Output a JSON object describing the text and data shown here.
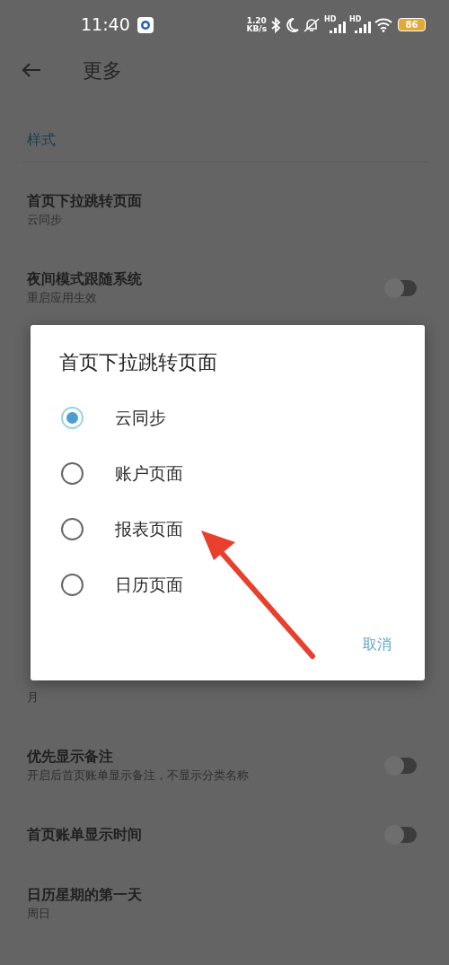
{
  "status_bar": {
    "time": "11:40",
    "net_speed": [
      "1.20",
      "KB/s"
    ],
    "signals": [
      {
        "label": "HD"
      },
      {
        "label": "HD"
      }
    ],
    "battery": "86"
  },
  "header": {
    "title": "更多"
  },
  "section": {
    "title": "样式"
  },
  "settings_above": [
    {
      "kind": "value",
      "title": "首页下拉跳转页面",
      "subtitle": "云同步"
    },
    {
      "kind": "toggle",
      "title": "夜间模式跟随系统",
      "subtitle": "重启应用生效",
      "on": false
    }
  ],
  "settings_below": [
    {
      "kind": "value",
      "subtitle": "月"
    },
    {
      "kind": "toggle",
      "title": "优先显示备注",
      "subtitle": "开启后首页账单显示备注，不显示分类名称",
      "on": false
    },
    {
      "kind": "toggle",
      "title": "首页账单显示时间",
      "on": false
    },
    {
      "kind": "value",
      "title": "日历星期的第一天",
      "subtitle": "周日"
    }
  ],
  "dialog": {
    "title": "首页下拉跳转页面",
    "options": [
      {
        "label": "云同步",
        "selected": true
      },
      {
        "label": "账户页面",
        "selected": false
      },
      {
        "label": "报表页面",
        "selected": false
      },
      {
        "label": "日历页面",
        "selected": false
      }
    ],
    "cancel": "取消"
  }
}
